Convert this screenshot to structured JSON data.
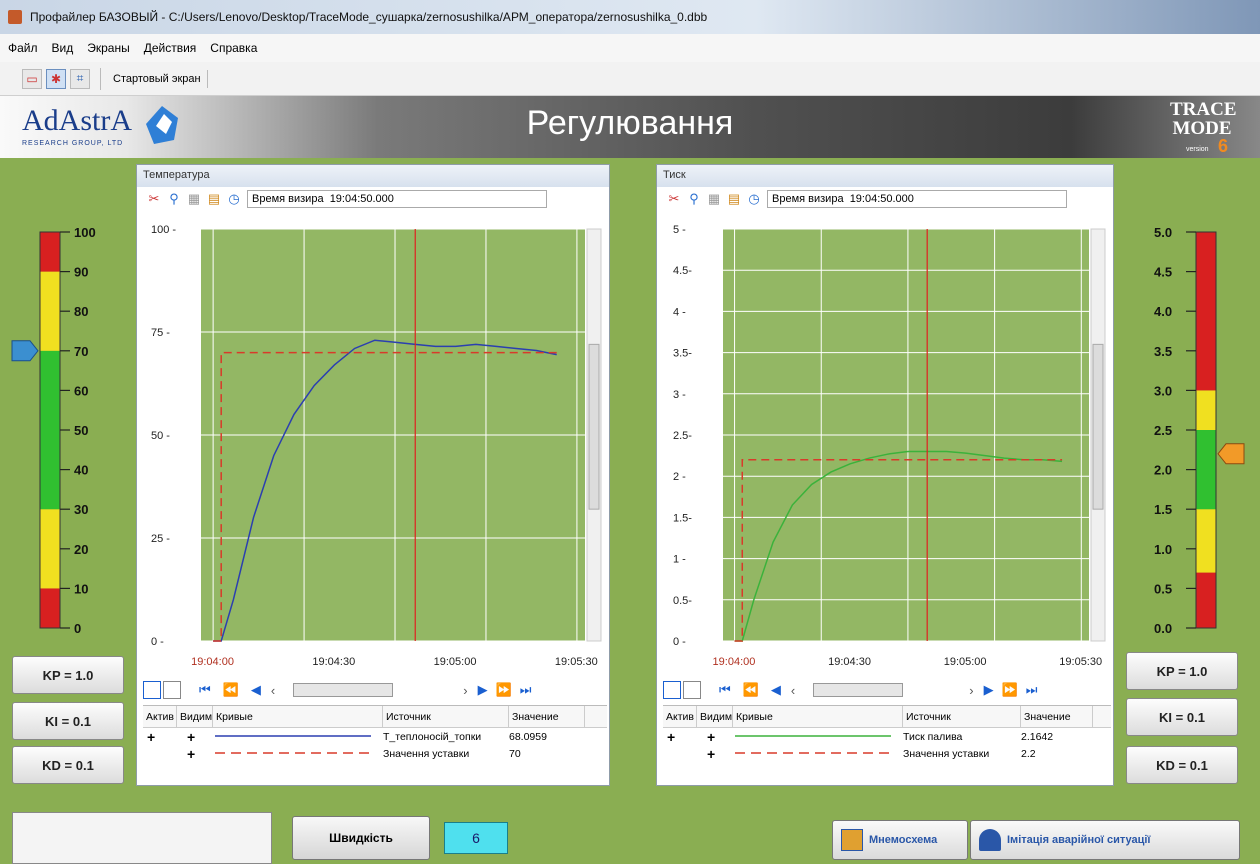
{
  "window": {
    "title": "Профайлер БАЗОВЫЙ - C:/Users/Lenovo/Desktop/TraceMode_сушарка/zernosushilka/АРМ_оператора/zernosushilka_0.dbb"
  },
  "menu": [
    "Файл",
    "Вид",
    "Экраны",
    "Действия",
    "Справка"
  ],
  "toolbar": {
    "screen_tab": "Стартовый экран"
  },
  "header": {
    "logo": "AdAstrA",
    "logo_sub": "RESEARCH GROUP, LTD",
    "title": "Регулювання",
    "tm_logo_line1": "TRACE",
    "tm_logo_line2": "MODE",
    "tm_version": "version",
    "tm_version_num": "6"
  },
  "temp_panel": {
    "title": "Температура",
    "vis_label": "Время визира",
    "vis_time": "19:04:50.000",
    "y_ticks": [
      "100 -",
      "75 -",
      "50 -",
      "25 -",
      "0 -"
    ],
    "x_ticks": [
      "19:04:00",
      "19:04:30",
      "19:05:00",
      "19:05:30"
    ],
    "legend_headers": [
      "Актив",
      "Видим",
      "Кривые",
      "Источник",
      "Значение"
    ],
    "legend_rows": [
      {
        "active": "+",
        "visible": "+",
        "source": "T_теплоносій_топки",
        "value": "68.0959",
        "color": "#2b3fb0"
      },
      {
        "active": "",
        "visible": "+",
        "source": "Значення уставки",
        "value": "70",
        "color": "#d93a2a"
      }
    ]
  },
  "press_panel": {
    "title": "Тиск",
    "vis_label": "Время визира",
    "vis_time": "19:04:50.000",
    "y_ticks": [
      "5 -",
      "4.5-",
      "4 -",
      "3.5-",
      "3 -",
      "2.5-",
      "2 -",
      "1.5-",
      "1 -",
      "0.5-",
      "0 -"
    ],
    "x_ticks": [
      "19:04:00",
      "19:04:30",
      "19:05:00",
      "19:05:30"
    ],
    "legend_headers": [
      "Актив",
      "Видим",
      "Кривые",
      "Источник",
      "Значение"
    ],
    "legend_rows": [
      {
        "active": "+",
        "visible": "+",
        "source": "Тиск палива",
        "value": "2.1642",
        "color": "#3bb23b"
      },
      {
        "active": "",
        "visible": "+",
        "source": "Значення уставки",
        "value": "2.2",
        "color": "#d93a2a"
      }
    ]
  },
  "left_gauge": {
    "labels": [
      "100",
      "90",
      "80",
      "70",
      "60",
      "50",
      "40",
      "30",
      "20",
      "10",
      "0"
    ],
    "level": 70
  },
  "right_gauge": {
    "labels": [
      "5.0",
      "4.5",
      "4.0",
      "3.5",
      "3.0",
      "2.5",
      "2.0",
      "1.5",
      "1.0",
      "0.5",
      "0.0"
    ],
    "level": 2.2
  },
  "left_buttons": {
    "kp": "KP = 1.0",
    "ki": "KI = 0.1",
    "kd": "KD = 0.1"
  },
  "right_buttons": {
    "kp": "KP = 1.0",
    "ki": "KI = 0.1",
    "kd": "KD = 0.1"
  },
  "bottom": {
    "speed_label": "Швидкість",
    "speed_value": "6",
    "mnemo": "Мнемосхема",
    "alarm": "Імітація аварійної ситуації"
  },
  "chart_data": [
    {
      "type": "line",
      "title": "Температура",
      "xlabel": "",
      "ylabel": "",
      "x": [
        "19:04:00",
        "19:04:02",
        "19:04:05",
        "19:04:10",
        "19:04:15",
        "19:04:20",
        "19:04:25",
        "19:04:30",
        "19:04:35",
        "19:04:40",
        "19:04:45",
        "19:04:50",
        "19:04:55",
        "19:05:00",
        "19:05:05",
        "19:05:10",
        "19:05:15",
        "19:05:20",
        "19:05:25"
      ],
      "series": [
        {
          "name": "T_теплоносій_топки",
          "values": [
            0,
            0,
            10,
            30,
            45,
            55,
            62,
            67,
            71,
            73,
            72.5,
            72,
            71.5,
            71.5,
            72,
            71.5,
            71,
            70.5,
            69.5
          ]
        },
        {
          "name": "Значення уставки",
          "values": [
            0,
            70,
            70,
            70,
            70,
            70,
            70,
            70,
            70,
            70,
            70,
            70,
            70,
            70,
            70,
            70,
            70,
            70,
            70
          ]
        }
      ],
      "ylim": [
        0,
        100
      ],
      "cursor": "19:04:50"
    },
    {
      "type": "line",
      "title": "Тиск",
      "xlabel": "",
      "ylabel": "",
      "x": [
        "19:04:00",
        "19:04:02",
        "19:04:05",
        "19:04:10",
        "19:04:15",
        "19:04:20",
        "19:04:25",
        "19:04:30",
        "19:04:35",
        "19:04:40",
        "19:04:45",
        "19:04:50",
        "19:04:55",
        "19:05:00",
        "19:05:05",
        "19:05:10",
        "19:05:15",
        "19:05:20",
        "19:05:25"
      ],
      "series": [
        {
          "name": "Тиск палива",
          "values": [
            0,
            0,
            0.5,
            1.2,
            1.65,
            1.9,
            2.05,
            2.15,
            2.22,
            2.27,
            2.3,
            2.3,
            2.3,
            2.28,
            2.25,
            2.22,
            2.2,
            2.2,
            2.18
          ]
        },
        {
          "name": "Значення уставки",
          "values": [
            0,
            2.2,
            2.2,
            2.2,
            2.2,
            2.2,
            2.2,
            2.2,
            2.2,
            2.2,
            2.2,
            2.2,
            2.2,
            2.2,
            2.2,
            2.2,
            2.2,
            2.2,
            2.2
          ]
        }
      ],
      "ylim": [
        0,
        5
      ],
      "cursor": "19:04:50"
    }
  ]
}
